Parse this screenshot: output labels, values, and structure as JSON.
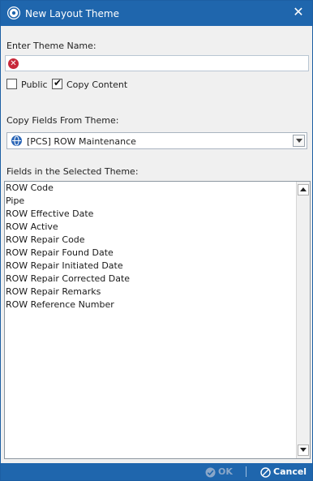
{
  "window": {
    "title": "New Layout Theme",
    "close_label": "✕"
  },
  "form": {
    "theme_name_label": "Enter Theme Name:",
    "theme_name_value": "",
    "public_label": "Public",
    "public_checked": false,
    "copy_content_label": "Copy Content",
    "copy_content_checked": true,
    "copy_fields_label": "Copy Fields From Theme:",
    "copy_fields_value": "[PCS] ROW Maintenance",
    "fields_list_label": "Fields in the Selected Theme:"
  },
  "fields": [
    "ROW Code",
    "Pipe",
    "ROW Effective Date",
    "ROW Active",
    "ROW Repair Code",
    "ROW Repair Found Date",
    "ROW Repair Initiated Date",
    "ROW Repair Corrected Date",
    "ROW Repair Remarks",
    "ROW Reference Number"
  ],
  "footer": {
    "ok_label": "OK",
    "cancel_label": "Cancel"
  },
  "colors": {
    "titlebar": "#1f66ad",
    "error": "#c8283a",
    "ok_disabled": "#8aa7c9"
  }
}
